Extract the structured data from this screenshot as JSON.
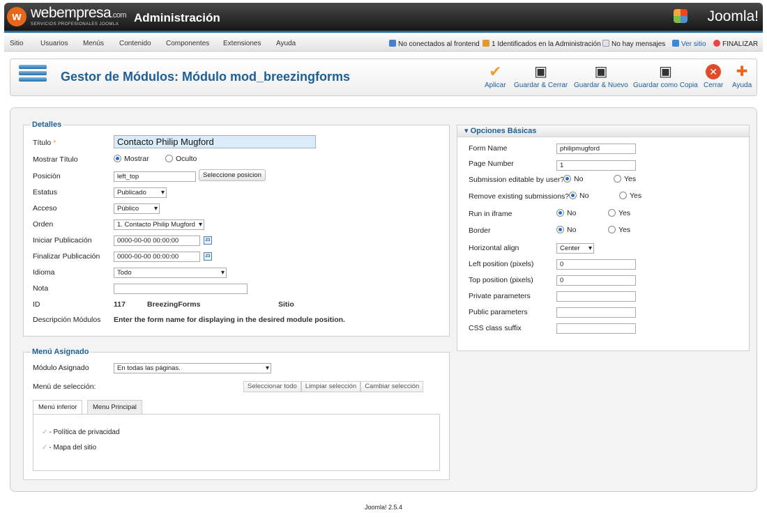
{
  "header": {
    "brand_logo_glyph": "w",
    "brand_name": "webempresa",
    "brand_name_suffix": ".com",
    "brand_tagline": "SERVICIOS PROFESIONALES JOOMLA",
    "admin_title": "Administración",
    "joomla_logo": "Joomla!"
  },
  "menu": {
    "items": [
      "Sitio",
      "Usuarios",
      "Menús",
      "Contenido",
      "Componentes",
      "Extensiones",
      "Ayuda"
    ],
    "status": {
      "frontend": "No conectados al frontend",
      "admin": "1 Identificados en la Administración",
      "messages": "No hay mensajes",
      "view_site": "Ver sitio",
      "logout": "FINALIZAR"
    }
  },
  "toolbar": {
    "title": "Gestor de Módulos: Módulo mod_breezingforms",
    "buttons": [
      {
        "label": "Aplicar",
        "icon": "check-icon"
      },
      {
        "label": "Guardar & Cerrar",
        "icon": "save-icon"
      },
      {
        "label": "Guardar & Nuevo",
        "icon": "save-new-icon"
      },
      {
        "label": "Guardar como Copia",
        "icon": "save-copy-icon"
      },
      {
        "label": "Cerrar",
        "icon": "close-icon"
      },
      {
        "label": "Ayuda",
        "icon": "help-icon"
      }
    ]
  },
  "details": {
    "legend": "Detalles",
    "title_label": "Título",
    "title_required": "*",
    "title_value": "Contacto Philip Mugford",
    "show_title_label": "Mostrar Título",
    "show_title_on": "Mostrar",
    "show_title_off": "Oculto",
    "position_label": "Posición",
    "position_value": "left_top",
    "position_button": "Seleccione posicion",
    "status_label": "Estatus",
    "status_value": "Publicado",
    "access_label": "Acceso",
    "access_value": "Público",
    "order_label": "Orden",
    "order_value": "1. Contacto Philip Mugford",
    "publish_start_label": "Iniciar Publicación",
    "publish_start_value": "0000-00-00 00:00:00",
    "publish_end_label": "Finalizar Publicación",
    "publish_end_value": "0000-00-00 00:00:00",
    "calendar_glyph": "23",
    "language_label": "Idioma",
    "language_value": "Todo",
    "note_label": "Nota",
    "note_value": "",
    "id_label": "ID",
    "id_value": "117",
    "module_name": "BreezingForms",
    "module_client": "Sitio",
    "description_label": "Descripción Módulos",
    "description_value": "Enter the form name for displaying in the desired module position."
  },
  "menu_assignment": {
    "legend": "Menú Asignado",
    "module_assignment_label": "Módulo Asignado",
    "module_assignment_value": "En todas las páginas.",
    "selection_label": "Menú de selección:",
    "select_all": "Seleccionar todo",
    "clear_selection": "Limpiar selección",
    "toggle_selection": "Cambiar selección",
    "tabs": [
      "Menú inferior",
      "Menu Principal"
    ],
    "items": [
      "- Política de privacidad",
      "- Mapa del sitio"
    ]
  },
  "basic_options": {
    "header": "Opciones Básicas",
    "form_name_label": "Form Name",
    "form_name_value": "philipmugford",
    "page_number_label": "Page Number",
    "page_number_value": "1",
    "submission_editable_label": "Submission editable by user?",
    "remove_submissions_label": "Remove existing submissions?",
    "run_iframe_label": "Run in iframe",
    "border_label": "Border",
    "no_label": "No",
    "yes_label": "Yes",
    "halign_label": "Horizontal align",
    "halign_value": "Center",
    "left_pos_label": "Left position (pixels)",
    "left_pos_value": "0",
    "top_pos_label": "Top position (pixels)",
    "top_pos_value": "0",
    "private_params_label": "Private parameters",
    "public_params_label": "Public parameters",
    "css_suffix_label": "CSS class suffix"
  },
  "footer": "Joomla! 2.5.4"
}
